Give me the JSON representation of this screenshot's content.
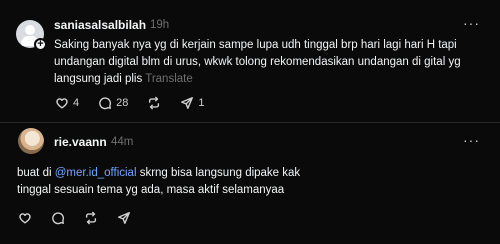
{
  "posts": [
    {
      "username": "saniasalsalbilah",
      "time": "19h",
      "text": "Saking banyak nya yg di kerjain sampe lupa udh tinggal brp hari lagi hari H tapi undangan digital blm di urus, wkwk tolong rekomendasikan undangan di gital yg langsung jadi plis",
      "translate_label": "Translate",
      "more_label": "···",
      "likes": "4",
      "replies": "28",
      "reposts": "",
      "shares": "1"
    },
    {
      "username": "rie.vaann",
      "time": "44m",
      "text_before": "buat di ",
      "mention": "@mer.id_official",
      "text_line1_after": " skrng bisa langsung dipake kak",
      "text_line2": "tinggal sesuain tema yg ada, masa aktif selamanyaa",
      "more_label": "···"
    }
  ],
  "icons": [
    "heart-icon",
    "comment-icon",
    "repost-icon",
    "share-icon",
    "more-icon",
    "plus-icon"
  ],
  "colors": {
    "background": "#0a0a0a",
    "text": "#f3f5f7",
    "muted": "#6f6f6f",
    "mention": "#6fa5ff",
    "divider": "#262626"
  }
}
